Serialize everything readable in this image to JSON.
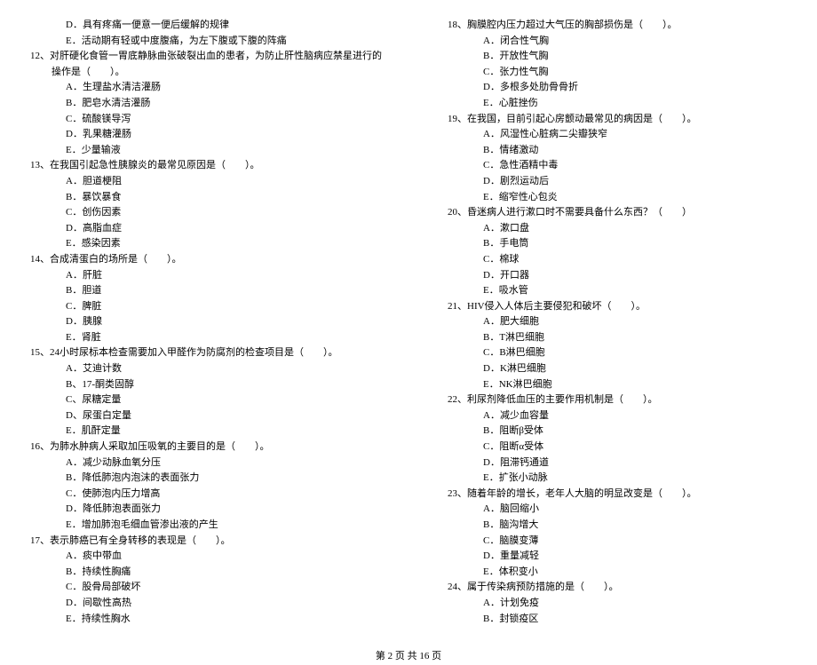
{
  "left": {
    "q11_tail_options": [
      "D．具有疼痛一便意一便后缓解的规律",
      "E．活动期有轻或中度腹痛，为左下腹或下腹的阵痛"
    ],
    "q12": {
      "stem": "12、对肝硬化食管一胃底静脉曲张破裂出血的患者，为防止肝性脑病应禁星进行的操作是（　　）。",
      "options": [
        "A．生理盐水清洁灌肠",
        "B．肥皂水清洁灌肠",
        "C．硫酸镁导泻",
        "D．乳果糖灌肠",
        "E．少量输液"
      ]
    },
    "q13": {
      "stem": "13、在我国引起急性胰腺炎的最常见原因是（　　）。",
      "options": [
        "A．胆道梗阻",
        "B．暴饮暴食",
        "C．创伤因素",
        "D．高脂血症",
        "E．感染因素"
      ]
    },
    "q14": {
      "stem": "14、合成清蛋白的场所是（　　）。",
      "options": [
        "A．肝脏",
        "B．胆道",
        "C．脾脏",
        "D．胰腺",
        "E．肾脏"
      ]
    },
    "q15": {
      "stem": "15、24小时尿标本检查需要加入甲醛作为防腐剂的检查项目是（　　）。",
      "options": [
        "A．艾迪计数",
        "B、17-酮类固醇",
        "C、尿糖定量",
        "D、尿蛋白定量",
        "E．肌酐定量"
      ]
    },
    "q16": {
      "stem": "16、为肺水肿病人采取加压吸氧的主要目的是（　　）。",
      "options": [
        "A．减少动脉血氧分压",
        "B．降低肺泡内泡沫的表面张力",
        "C．使肺泡内压力增高",
        "D．降低肺泡表面张力",
        "E．增加肺泡毛细血管渗出液的产生"
      ]
    },
    "q17": {
      "stem": "17、表示肺癌已有全身转移的表现是（　　）。",
      "options": [
        "A．痰中带血",
        "B．持续性胸痛",
        "C．股骨局部破坏",
        "D．间歇性高热",
        "E．持续性胸水"
      ]
    }
  },
  "right": {
    "q18": {
      "stem": "18、胸膜腔内压力超过大气压的胸部损伤是（　　）。",
      "options": [
        "A．闭合性气胸",
        "B．开放性气胸",
        "C．张力性气胸",
        "D．多根多处肋骨骨折",
        "E．心脏挫伤"
      ]
    },
    "q19": {
      "stem": "19、在我国，目前引起心房颤动最常见的病因是（　　）。",
      "options": [
        "A．风湿性心脏病二尖瓣狭窄",
        "B．情绪激动",
        "C．急性酒精中毒",
        "D．剧烈运动后",
        "E．缩窄性心包炎"
      ]
    },
    "q20": {
      "stem": "20、昏迷病人进行漱口时不需要具备什么东西？（　　）",
      "options": [
        "A．漱口盘",
        "B．手电筒",
        "C．棉球",
        "D．开口器",
        "E．吸水管"
      ]
    },
    "q21": {
      "stem": "21、HIV侵入人体后主要侵犯和破坏（　　）。",
      "options": [
        "A．肥大细胞",
        "B．T淋巴细胞",
        "C．B淋巴细胞",
        "D．K淋巴细胞",
        "E．NK淋巴细胞"
      ]
    },
    "q22": {
      "stem": "22、利尿剂降低血压的主要作用机制是（　　）。",
      "options": [
        "A．减少血容量",
        "B．阻断β受体",
        "C．阻断α受体",
        "D．阻滞钙通道",
        "E．扩张小动脉"
      ]
    },
    "q23": {
      "stem": "23、随着年龄的增长，老年人大脑的明显改变是（　　）。",
      "options": [
        "A．脑回缩小",
        "B．脑沟增大",
        "C．脑膜变薄",
        "D．重量减轻",
        "E．体积变小"
      ]
    },
    "q24": {
      "stem": "24、属于传染病预防措施的是（　　）。",
      "options": [
        "A．计划免疫",
        "B．封锁疫区"
      ]
    }
  },
  "footer": "第 2 页 共 16 页"
}
